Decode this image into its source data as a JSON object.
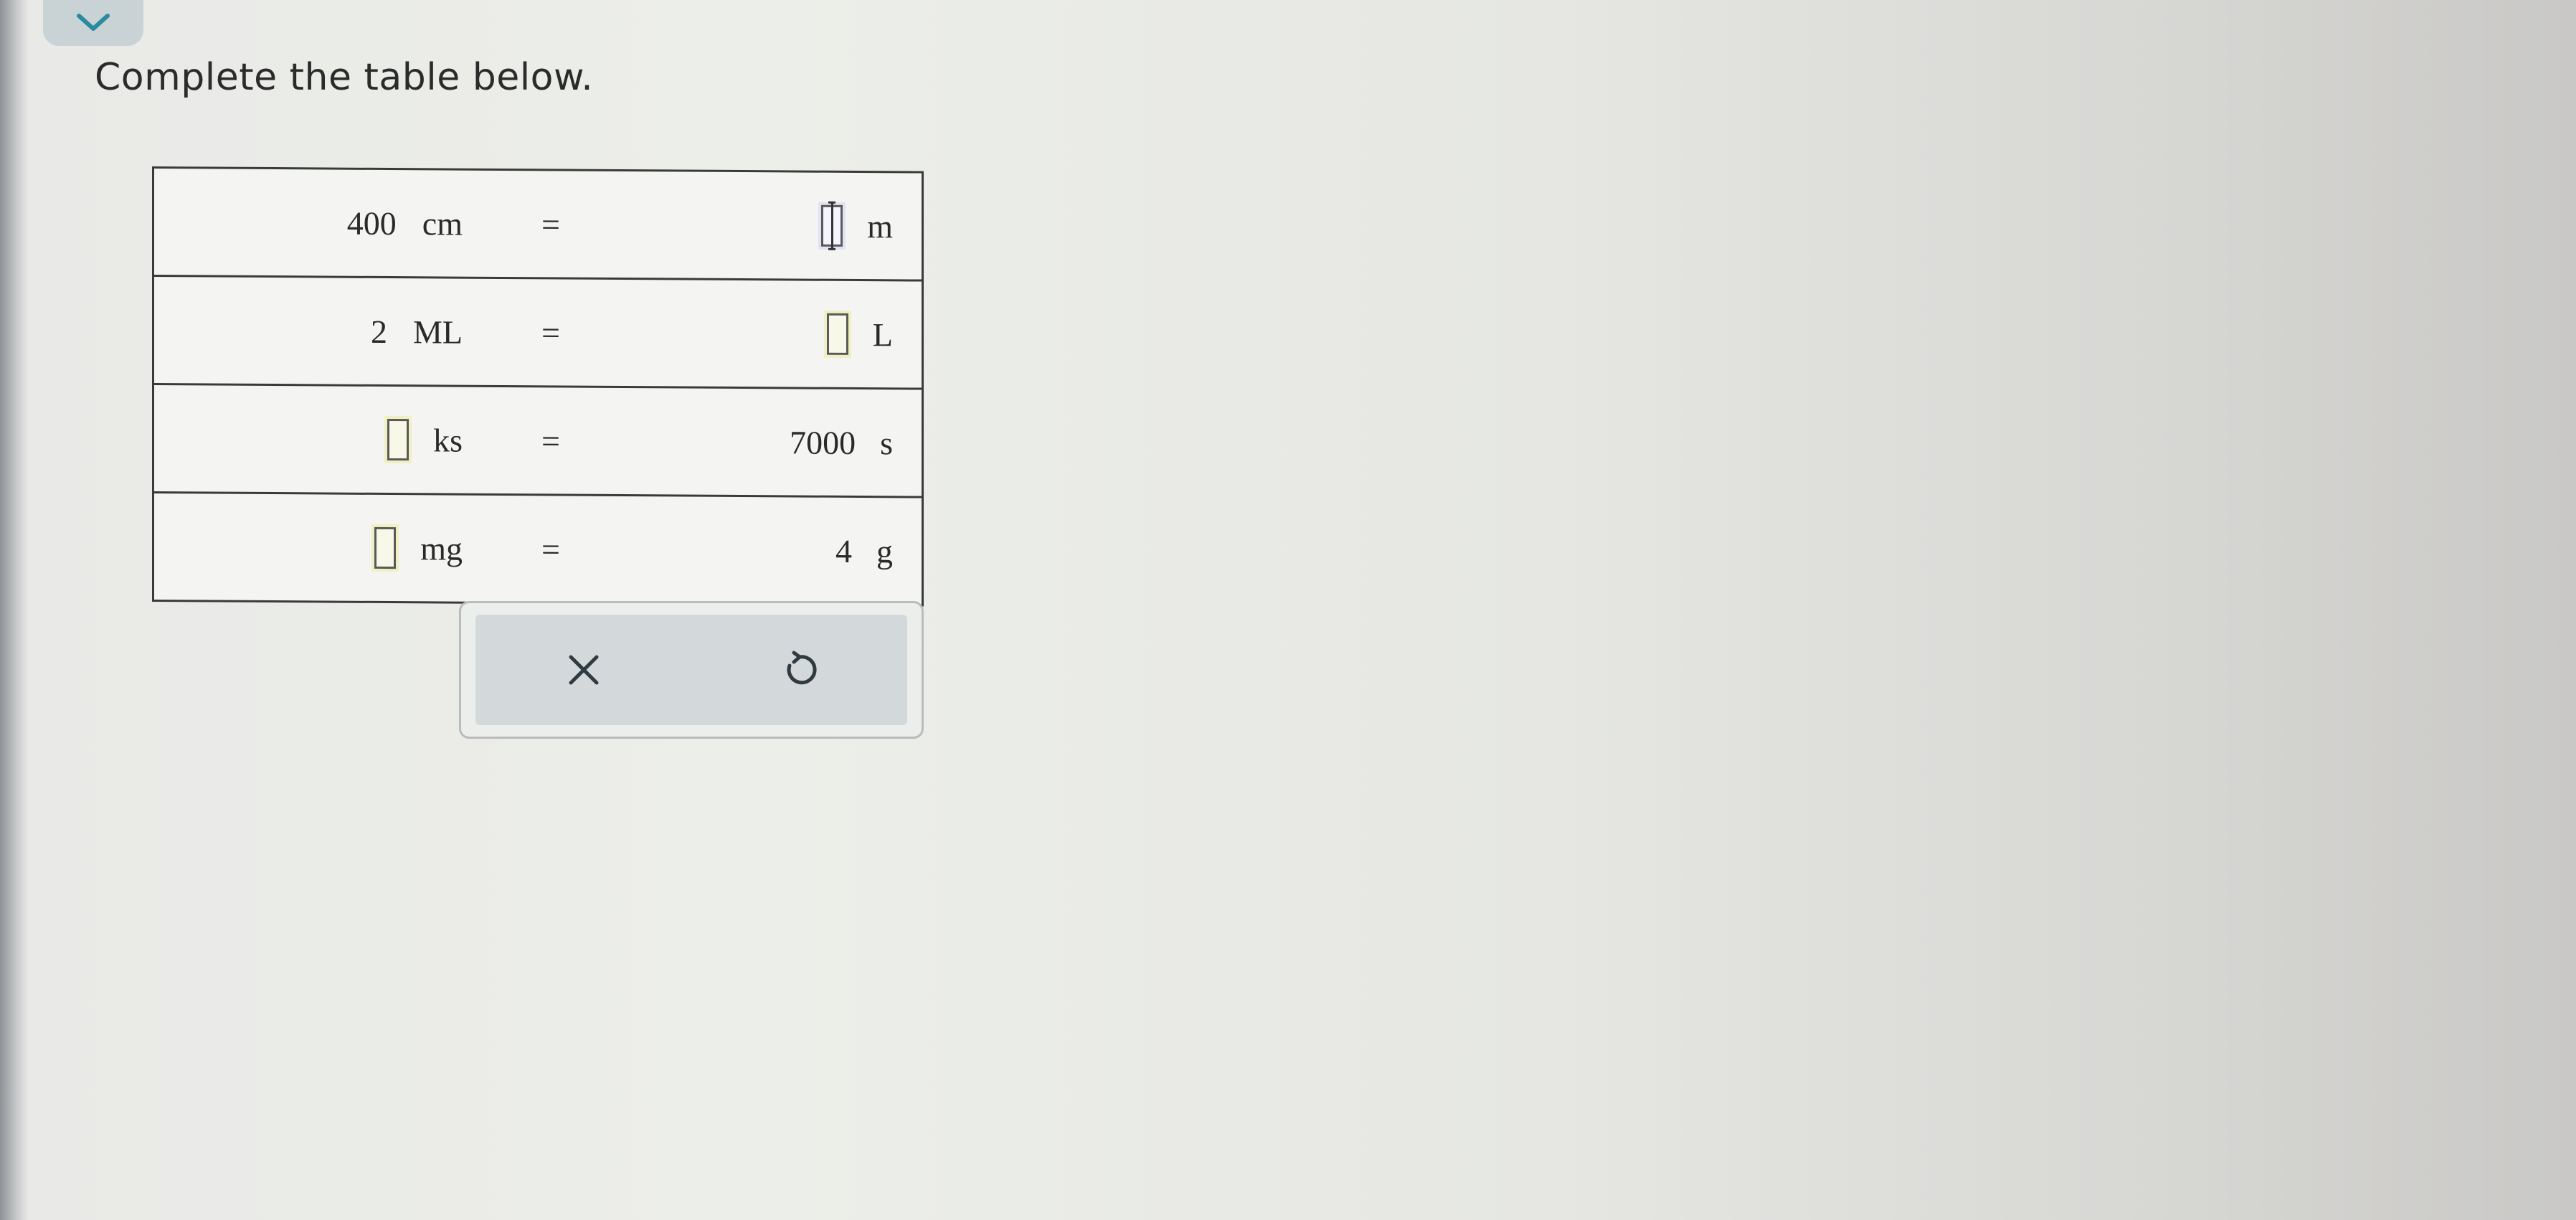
{
  "question": {
    "prompt": "Complete the table below."
  },
  "table": {
    "rows": [
      {
        "lhs_value": "400",
        "lhs_unit": "cm",
        "equals": "=",
        "rhs_value": "",
        "rhs_unit": "m"
      },
      {
        "lhs_value": "2",
        "lhs_unit": "ML",
        "equals": "=",
        "rhs_value": "",
        "rhs_unit": "L"
      },
      {
        "lhs_value": "",
        "lhs_unit": "ks",
        "equals": "=",
        "rhs_value": "7000",
        "rhs_unit": "s"
      },
      {
        "lhs_value": "",
        "lhs_unit": "mg",
        "equals": "=",
        "rhs_value": "4",
        "rhs_unit": "g"
      }
    ]
  },
  "icons": {
    "collapse": "chevron-down-icon",
    "clear": "close-icon",
    "undo": "undo-icon"
  },
  "colors": {
    "accent": "#2a8aa0",
    "answer_box_highlight": "#f0f0c2"
  }
}
